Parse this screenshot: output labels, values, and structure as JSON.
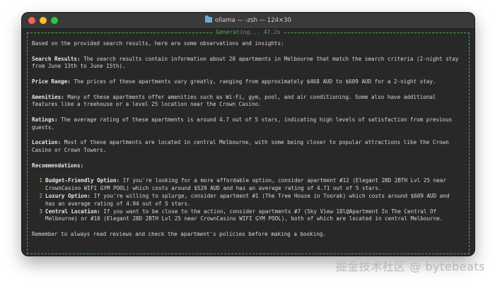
{
  "window": {
    "title": "ollama — -zsh — 124×30",
    "colors": {
      "close": "#ff5f57",
      "minimize": "#febc2e",
      "zoom": "#28c840"
    }
  },
  "generating": "Generating... 47.2s",
  "content": {
    "intro": "Based on the provided search results, here are some observations and insights:",
    "sections": [
      {
        "label": "Search Results:",
        "text": " The search results contain information about 20 apartments in Melbourne that match the search criteria (2-night stay from June 13th to June 15th)."
      },
      {
        "label": "Price Range:",
        "text": " The prices of these apartments vary greatly, ranging from approximately $468 AUD to $609 AUD for a 2-night stay."
      },
      {
        "label": "Amenities:",
        "text": " Many of these apartments offer amenities such as Wi-Fi, gym, pool, and air conditioning. Some also have additional features like a treehouse or a level 25 location near the Crown Casino."
      },
      {
        "label": "Ratings:",
        "text": " The average rating of these apartments is around 4.7 out of 5 stars, indicating high levels of satisfaction from previous guests."
      },
      {
        "label": "Location:",
        "text": " Most of these apartments are located in central Melbourne, with some being closer to popular attractions like the Crown Casino or Crown Towers."
      }
    ],
    "recommendations_heading": "Recommendations:",
    "recommendations": [
      {
        "num": "1",
        "label": "Budget-Friendly Option:",
        "text": " If you're looking for a more affordable option, consider apartment #12 (Elegant 2BD 2BTH Lvl 25 near CrownCasino WIFI GYM POOL) which costs around $529 AUD and has an average rating of 4.71 out of 5 stars."
      },
      {
        "num": "2",
        "label": "Luxury Option:",
        "text": " If you're willing to splurge, consider apartment #1 (The Tree House in Toorak) which costs around $609 AUD and has an average rating of 4.94 out of 5 stars."
      },
      {
        "num": "3",
        "label": "Central Location:",
        "text": " If you want to be close to the action, consider apartments #7 (Sky View 18l@Apartment In The Central Of Melbourne) or #10 (Elegant 2BD 2BTH Lvl 25 near CrownCasino WIFI GYM POOL), both of which are located in central Melbourne."
      }
    ],
    "closing": "Remember to always read reviews and check the apartment's policies before making a booking."
  },
  "watermark": "掘金技术社区 @ bytebeats"
}
